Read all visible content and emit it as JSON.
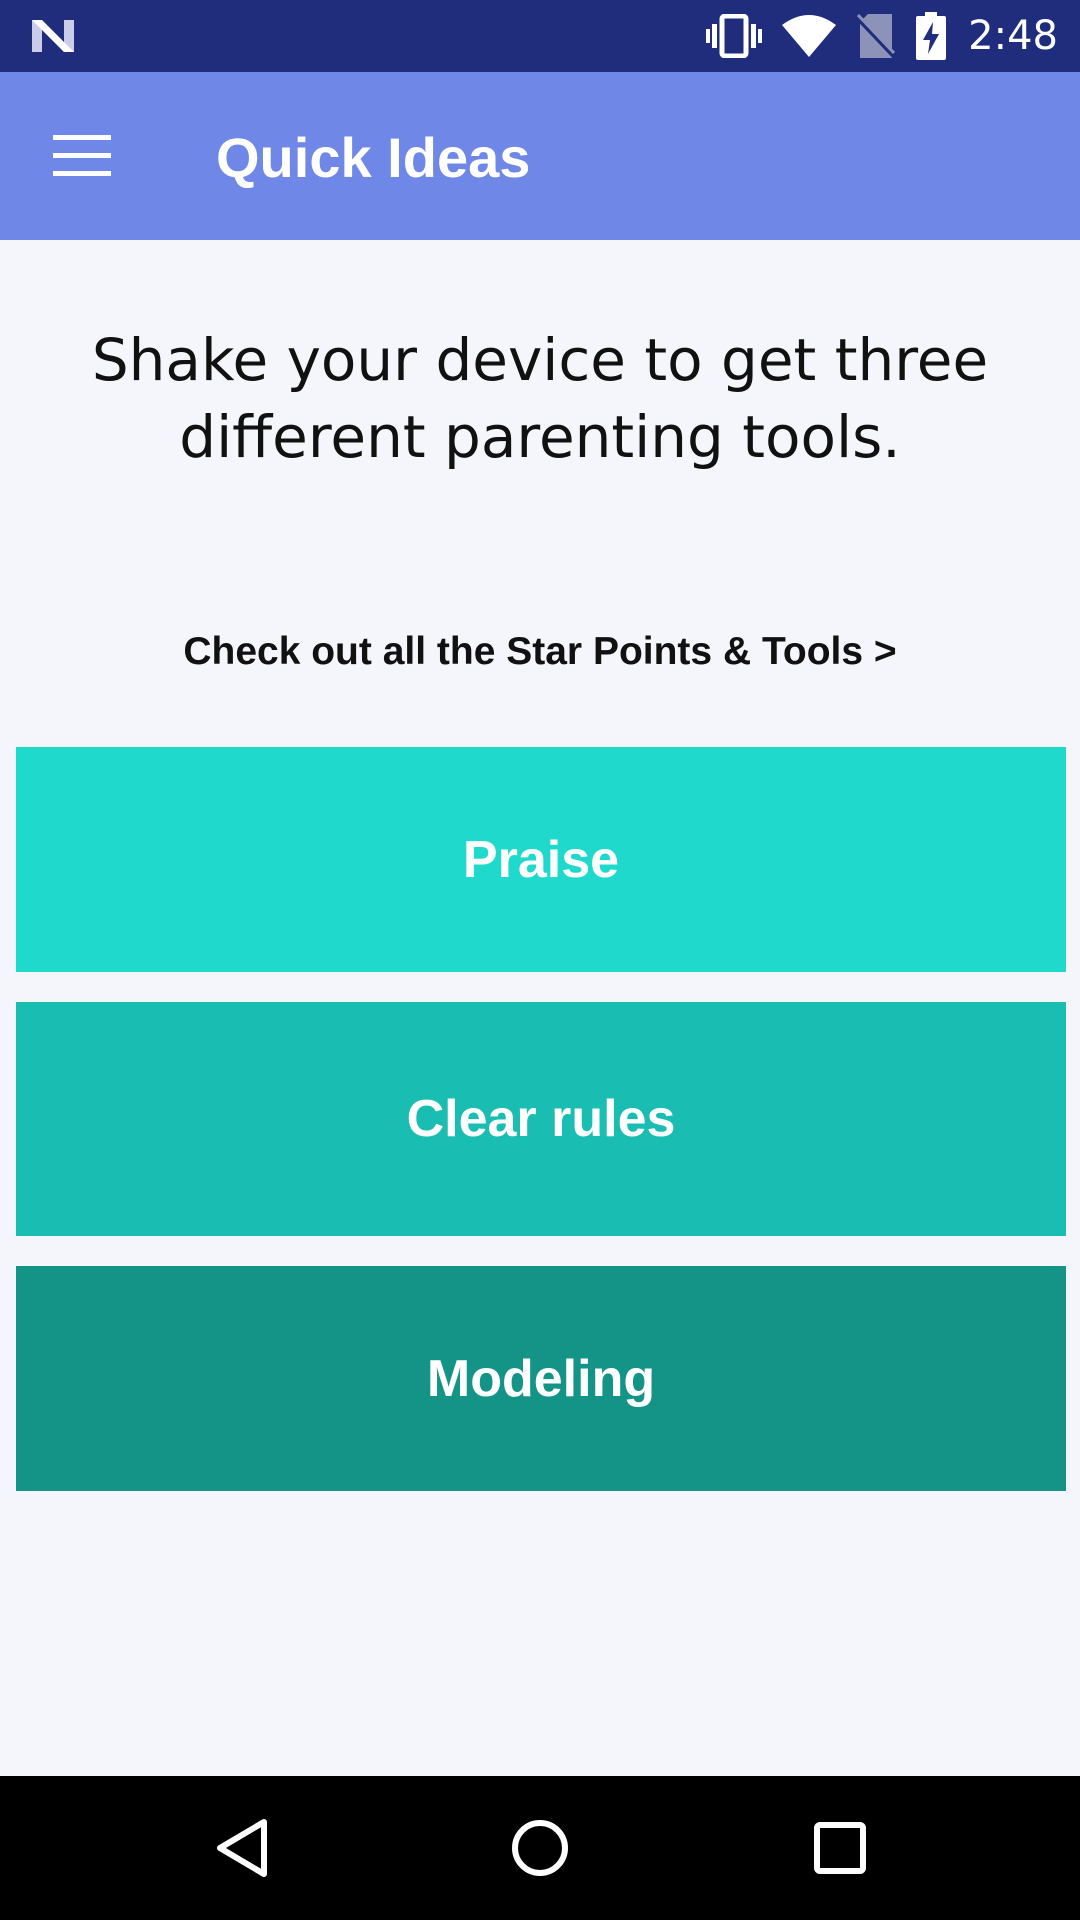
{
  "status_bar": {
    "time": "2:48",
    "icons": [
      "n-logo-icon",
      "vibrate-icon",
      "wifi-icon",
      "no-sim-icon",
      "battery-charging-icon"
    ]
  },
  "app_bar": {
    "title": "Quick Ideas",
    "menu_icon": "hamburger-menu-icon"
  },
  "main": {
    "instructions": "Shake your device to get three different parenting tools.",
    "tools_link": "Check out all the Star Points & Tools >",
    "tools": [
      {
        "label": "Praise",
        "color": "#1fd9cc"
      },
      {
        "label": "Clear rules",
        "color": "#19bdb1"
      },
      {
        "label": "Modeling",
        "color": "#149487"
      }
    ]
  },
  "colors": {
    "status_bar": "#1f2d7c",
    "app_bar": "#6f87e6",
    "background": "#f5f6fc",
    "nav_bar": "#000000"
  },
  "nav_bar": {
    "buttons": [
      "back-icon",
      "home-icon",
      "recents-icon"
    ]
  }
}
